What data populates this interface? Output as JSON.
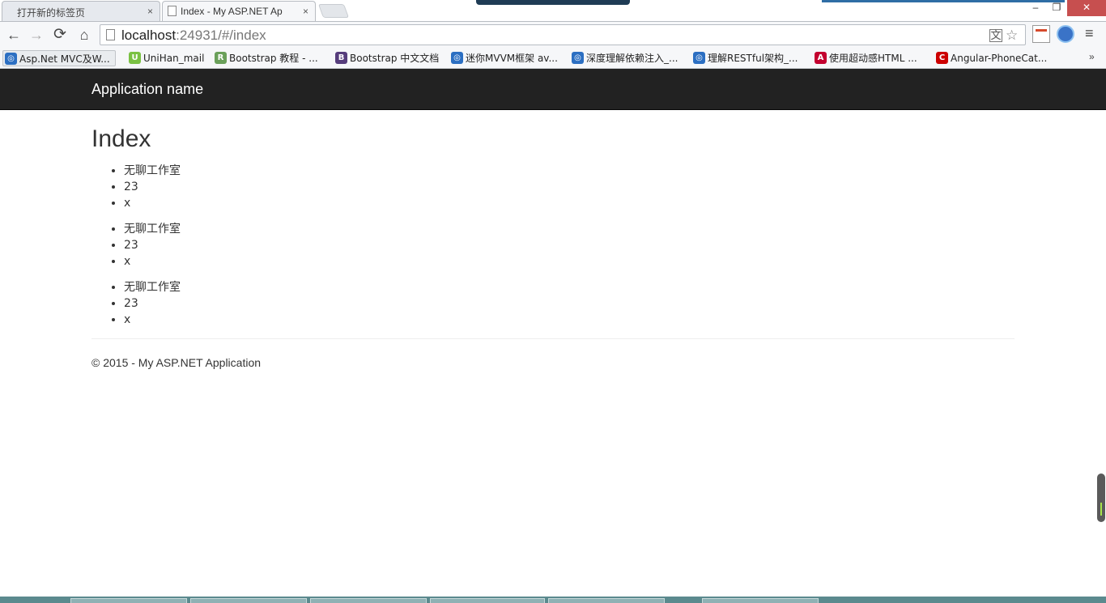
{
  "browser": {
    "tabs": [
      {
        "title": "打开新的标签页",
        "active": false
      },
      {
        "title": "Index - My ASP.NET Ap",
        "active": true
      }
    ],
    "tab_close_glyph": "×",
    "window_controls": {
      "minimize": "–",
      "maximize": "❐",
      "close": "✕"
    },
    "nav": {
      "back": "←",
      "forward": "→",
      "reload": "⟳",
      "home": "⌂"
    },
    "address": {
      "host": "localhost",
      "rest": ":24931/#/index"
    },
    "star_glyph": "☆",
    "translate_glyph": "文",
    "menu_glyph": "≡",
    "bookmarks": [
      {
        "label": "Asp.Net MVC及W...",
        "icon": "globe-icon",
        "color": "#2c6fc2",
        "glyph": "◎"
      },
      {
        "label": "UniHan_mail",
        "icon": "unihan-icon",
        "color": "#7ac143",
        "glyph": "U"
      },
      {
        "label": "Bootstrap 教程 - ...",
        "icon": "runoob-icon",
        "color": "#6aa05a",
        "glyph": "R"
      },
      {
        "label": "Bootstrap 中文文档",
        "icon": "bootstrap-icon",
        "color": "#563d7c",
        "glyph": "B"
      },
      {
        "label": "迷你MVVM框架 av...",
        "icon": "globe-icon",
        "color": "#2c6fc2",
        "glyph": "◎"
      },
      {
        "label": "深度理解依赖注入_...",
        "icon": "globe-icon",
        "color": "#2c6fc2",
        "glyph": "◎"
      },
      {
        "label": "理解RESTful架构_...",
        "icon": "globe-icon",
        "color": "#2c6fc2",
        "glyph": "◎"
      },
      {
        "label": "使用超动感HTML ...",
        "icon": "angular-icon",
        "color": "#c3002f",
        "glyph": "A"
      },
      {
        "label": "Angular-PhoneCat...",
        "icon": "c-icon",
        "color": "#cc0000",
        "glyph": "C"
      }
    ],
    "bookmarks_more": "»"
  },
  "navbar": {
    "brand": "Application name"
  },
  "main": {
    "title": "Index",
    "lists": [
      {
        "items": [
          "无聊工作室",
          "23",
          "x"
        ]
      },
      {
        "items": [
          "无聊工作室",
          "23",
          "x"
        ]
      },
      {
        "items": [
          "无聊工作室",
          "23",
          "x"
        ]
      }
    ]
  },
  "footer": {
    "text": "© 2015 - My ASP.NET Application"
  }
}
